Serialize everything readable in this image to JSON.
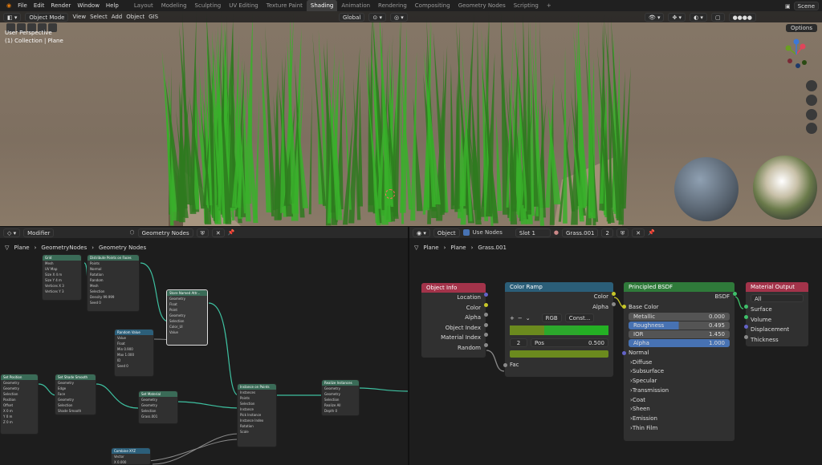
{
  "menu": [
    "File",
    "Edit",
    "Render",
    "Window",
    "Help"
  ],
  "workspaces": [
    "Layout",
    "Modeling",
    "Sculpting",
    "UV Editing",
    "Texture Paint",
    "Shading",
    "Animation",
    "Rendering",
    "Compositing",
    "Geometry Nodes",
    "Scripting",
    "+"
  ],
  "active_workspace": "Shading",
  "scene": "Scene",
  "viewport": {
    "mode": "Object Mode",
    "menus": [
      "View",
      "Select",
      "Add",
      "Object",
      "GIS"
    ],
    "orientation": "Global",
    "info_line1": "User Perspective",
    "info_line2": "(1) Collection | Plane",
    "options": "Options"
  },
  "geo_editor": {
    "type": "Modifier",
    "tree": "Geometry Nodes",
    "breadcrumb": [
      "Plane",
      "GeometryNodes",
      "Geometry Nodes"
    ]
  },
  "geo_nodes": [
    {
      "title": "Grid",
      "color": "#3a6b57",
      "rows": [
        "Mesh",
        "UV Map",
        "Size X 4 m",
        "Size Y 4 m",
        "Vertices X 3",
        "Vertices Y 3"
      ]
    },
    {
      "title": "Distribute Points on Faces",
      "color": "#3a6b57",
      "rows": [
        "Points",
        "Normal",
        "Rotation",
        "Random",
        "Mesh",
        "Selection",
        "Density 99.999",
        "Seed 0"
      ]
    },
    {
      "title": "Store Named Attr...",
      "color": "#3a6b57",
      "rows": [
        "Geometry",
        "Float",
        "Point",
        "Geometry",
        "Selection",
        "Color_UI",
        "Value"
      ]
    },
    {
      "title": "Random Value",
      "color": "#2c5f7a",
      "rows": [
        "Value",
        "Float",
        "Min 0.900",
        "Max 1.000",
        "ID",
        "Seed 0"
      ]
    },
    {
      "title": "Set Position",
      "color": "#3a6b57",
      "rows": [
        "Geometry",
        "Geometry",
        "Selection",
        "Position",
        "Offset",
        "X 0 m",
        "Y 0 m",
        "Z 0 m"
      ]
    },
    {
      "title": "Set Shade Smooth",
      "color": "#3a6b57",
      "rows": [
        "Geometry",
        "Edge",
        "Face",
        "Geometry",
        "Selection",
        "Shade Smooth"
      ]
    },
    {
      "title": "Set Material",
      "color": "#3a6b57",
      "rows": [
        "Geometry",
        "Geometry",
        "Selection",
        "Grass.001"
      ]
    },
    {
      "title": "Instance on Points",
      "color": "#3a6b57",
      "rows": [
        "Instances",
        "Points",
        "Selection",
        "Instance",
        "Pick Instance",
        "Instance Index",
        "Rotation",
        "Scale"
      ]
    },
    {
      "title": "Realize Instances",
      "color": "#3a6b57",
      "rows": [
        "Geometry",
        "Geometry",
        "Selection",
        "Realize All",
        "Depth 0"
      ]
    },
    {
      "title": "Combine XYZ",
      "color": "#2c5f7a",
      "rows": [
        "Vector",
        "X 0.000"
      ]
    }
  ],
  "shader_editor": {
    "type": "Object",
    "use_nodes": "Use Nodes",
    "slot": "Slot 1",
    "material": "Grass.001",
    "users": "2",
    "breadcrumb": [
      "Plane",
      "Plane",
      "Grass.001"
    ]
  },
  "object_info": {
    "title": "Object Info",
    "outputs": [
      "Location",
      "Color",
      "Alpha",
      "Object Index",
      "Material Index",
      "Random"
    ]
  },
  "color_ramp": {
    "title": "Color Ramp",
    "outputs": [
      "Color",
      "Alpha"
    ],
    "mode": "RGB",
    "interp": "Const...",
    "index": "2",
    "pos_label": "Pos",
    "pos": "0.500",
    "input": "Fac",
    "colors": [
      "#6b8a1e",
      "#2ca82c",
      "#24b024"
    ]
  },
  "bsdf": {
    "title": "Principled BSDF",
    "output": "BSDF",
    "base": "Base Color",
    "fields": [
      {
        "label": "Metallic",
        "value": "0.000",
        "fill": 0
      },
      {
        "label": "Roughness",
        "value": "0.495",
        "fill": 0.495
      },
      {
        "label": "IOR",
        "value": "1.450",
        "fill": 0
      },
      {
        "label": "Alpha",
        "value": "1.000",
        "fill": 1
      }
    ],
    "normal": "Normal",
    "panels": [
      "Diffuse",
      "Subsurface",
      "Specular",
      "Transmission",
      "Coat",
      "Sheen",
      "Emission",
      "Thin Film"
    ]
  },
  "material_output": {
    "title": "Material Output",
    "target": "All",
    "inputs": [
      "Surface",
      "Volume",
      "Displacement",
      "Thickness"
    ]
  },
  "colors": {
    "grass_dark": "#2e7a1e",
    "grass_light": "#38b02a",
    "node_header_input": "#a3334a",
    "node_header_converter": "#2b5e78",
    "node_header_shader": "#2f7a3a",
    "node_header_output": "#a3334a"
  }
}
